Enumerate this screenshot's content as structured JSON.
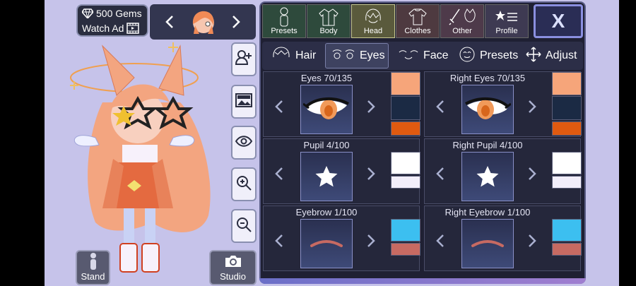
{
  "currency": {
    "gems": "500 Gems",
    "watch_ad": "Watch Ad"
  },
  "left_tools": [
    "add-user-icon",
    "background-icon",
    "eye-icon",
    "zoom-in-icon",
    "zoom-out-icon"
  ],
  "bottom_buttons": {
    "stand": "Stand",
    "studio": "Studio"
  },
  "categories": [
    {
      "label": "Presets",
      "icon": "person-icon",
      "bg": "#2e4a3c"
    },
    {
      "label": "Body",
      "icon": "jacket-icon",
      "bg": "#2e4a3c"
    },
    {
      "label": "Head",
      "icon": "hair-icon",
      "bg": "#5a5a3c",
      "active": true
    },
    {
      "label": "Clothes",
      "icon": "shirt-icon",
      "bg": "#4e3a40"
    },
    {
      "label": "Other",
      "icon": "sword-cat-icon",
      "bg": "#4e3a4a"
    },
    {
      "label": "Profile",
      "icon": "star-list-icon",
      "bg": "#3e3a52"
    }
  ],
  "close_label": "X",
  "subtabs": [
    {
      "label": "Hair",
      "icon": "hair-outline-icon"
    },
    {
      "label": "Eyes",
      "icon": "eyes-icon",
      "active": true
    },
    {
      "label": "Face",
      "icon": "face-icon"
    },
    {
      "label": "Presets",
      "icon": "smiley-icon"
    },
    {
      "label": "Adjust",
      "icon": "move-icon"
    }
  ],
  "cells": [
    {
      "title": "Eyes 70/135",
      "thumb": "eye-thumb",
      "colors": [
        "#f6a57a",
        "#1b2a44",
        "#e05a10"
      ]
    },
    {
      "title": "Right Eyes 70/135",
      "thumb": "eye-thumb",
      "colors": [
        "#f6a57a",
        "#1b2a44",
        "#e05a10"
      ]
    },
    {
      "title": "Pupil 4/100",
      "thumb": "star-thumb",
      "colors": [
        "#ffffff",
        "#f2eefa"
      ]
    },
    {
      "title": "Right Pupil 4/100",
      "thumb": "star-thumb",
      "colors": [
        "#ffffff",
        "#f2eefa"
      ]
    },
    {
      "title": "Eyebrow 1/100",
      "thumb": "brow-thumb",
      "colors": [
        "#3cbff0",
        "#c76a62"
      ]
    },
    {
      "title": "Right Eyebrow 1/100",
      "thumb": "brow-thumb",
      "colors": [
        "#3cbff0",
        "#c76a62"
      ]
    }
  ]
}
